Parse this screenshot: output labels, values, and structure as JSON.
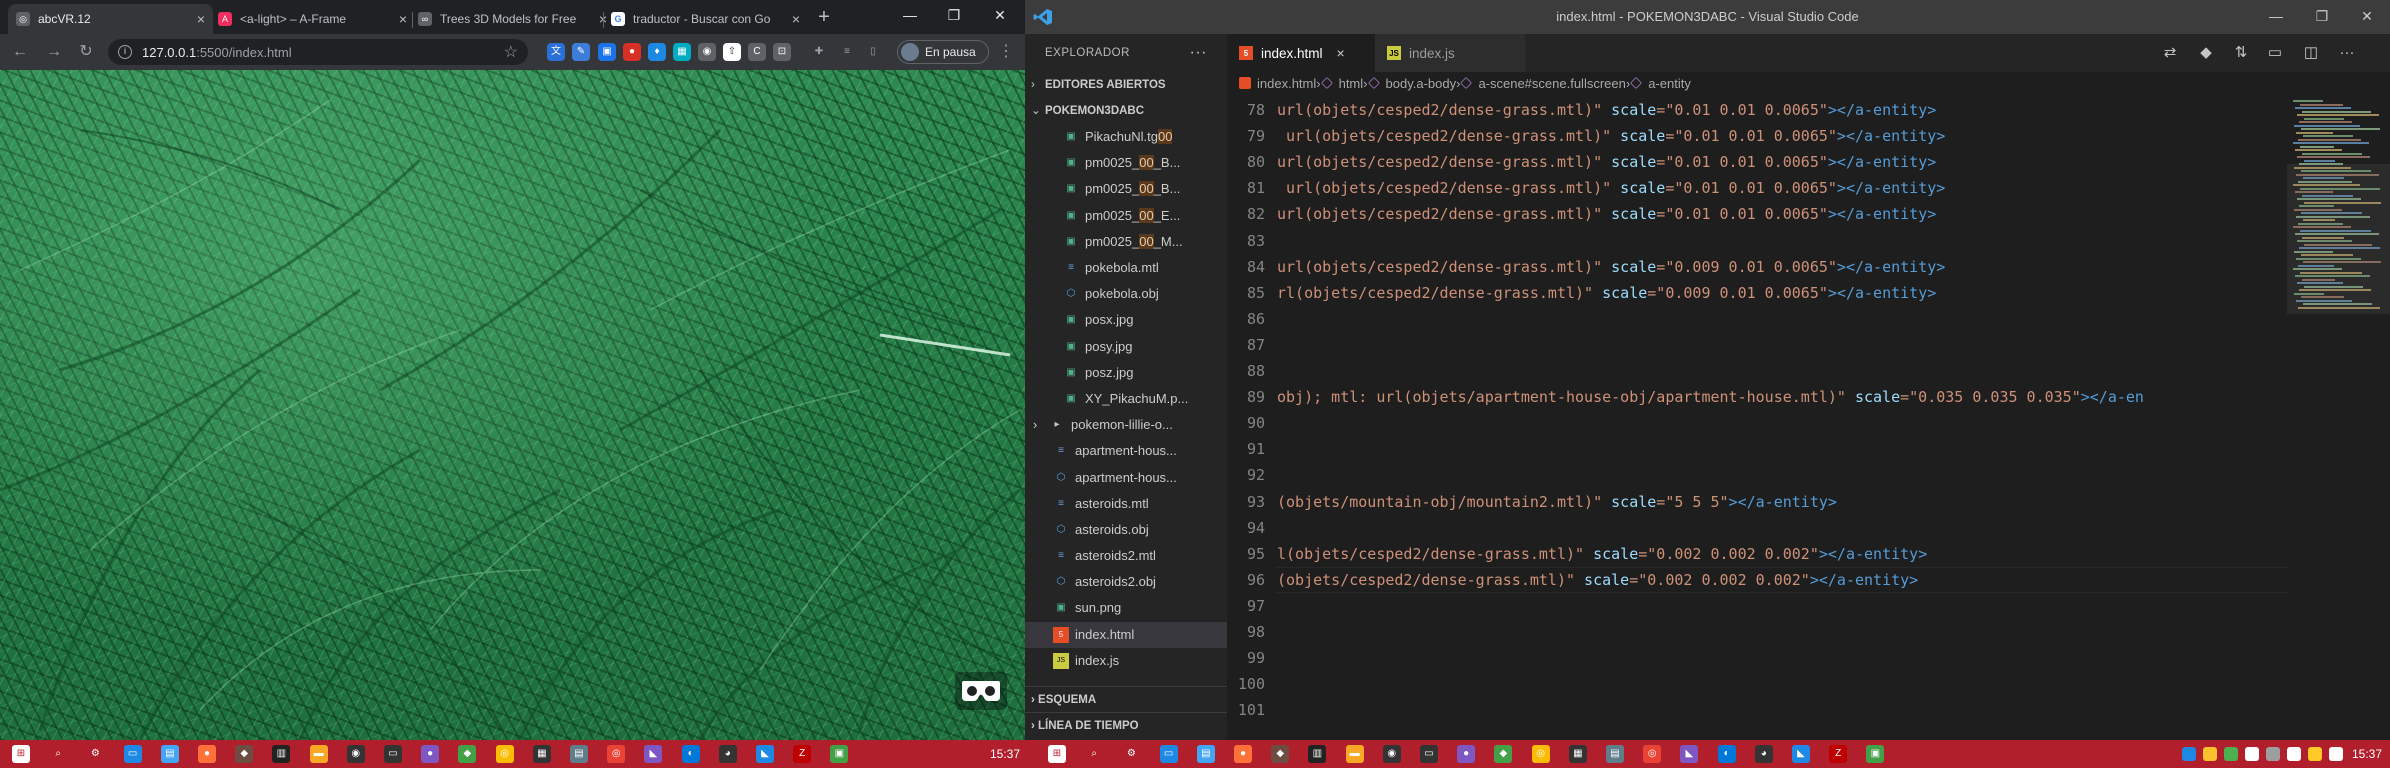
{
  "browser": {
    "tabs": [
      {
        "label": "abcVR.12",
        "icon": "globe-icon",
        "color": "#5f6368"
      },
      {
        "label": "<a-light> – A-Frame",
        "icon": "aframe-icon",
        "color": "#ef2d5e"
      },
      {
        "label": "Trees 3D Models for Free",
        "icon": "link-icon",
        "color": "#5f6368"
      },
      {
        "label": "traductor - Buscar con Go",
        "icon": "google-icon",
        "color": "#ffffff"
      }
    ],
    "close_glyph": "×",
    "new_tab_glyph": "+",
    "url_host": "127.0.0.1",
    "url_path": ":5500/index.html",
    "profile_label": "En pausa",
    "accent_color": "#2f8a52"
  },
  "vscode": {
    "window_title": "index.html - POKEMON3DABC - Visual Studio Code",
    "explorer_title": "EXPLORADOR",
    "open_editors": "EDITORES ABIERTOS",
    "project": "POKEMON3DABC",
    "files": [
      {
        "name": "PikachuNl.tg",
        "suffix": "00",
        "icon": "image-file-icon",
        "indent": 2
      },
      {
        "name": "pm0025_",
        "mid": "00",
        "suffix": "_B...",
        "icon": "image-file-icon",
        "indent": 2
      },
      {
        "name": "pm0025_",
        "mid": "00",
        "suffix": "_B...",
        "icon": "image-file-icon",
        "indent": 2
      },
      {
        "name": "pm0025_",
        "mid": "00",
        "suffix": "_E...",
        "icon": "image-file-icon",
        "indent": 2
      },
      {
        "name": "pm0025_",
        "mid": "00",
        "suffix": "_M...",
        "icon": "image-file-icon",
        "indent": 2
      },
      {
        "name": "pokebola.mtl",
        "icon": "text-file-icon",
        "indent": 2
      },
      {
        "name": "pokebola.obj",
        "icon": "cube-file-icon",
        "indent": 2
      },
      {
        "name": "posx.jpg",
        "icon": "image-file-icon",
        "indent": 2
      },
      {
        "name": "posy.jpg",
        "icon": "image-file-icon",
        "indent": 2
      },
      {
        "name": "posz.jpg",
        "icon": "image-file-icon",
        "indent": 2
      },
      {
        "name": "XY_PikachuM.p...",
        "icon": "image-file-icon",
        "indent": 2
      },
      {
        "name": "pokemon-lillie-o...",
        "icon": "folder-icon",
        "indent": 1,
        "folder": true
      },
      {
        "name": "apartment-hous...",
        "icon": "text-file-icon",
        "indent": 1
      },
      {
        "name": "apartment-hous...",
        "icon": "cube-file-icon",
        "indent": 1
      },
      {
        "name": "asteroids.mtl",
        "icon": "text-file-icon",
        "indent": 1
      },
      {
        "name": "asteroids.obj",
        "icon": "cube-file-icon",
        "indent": 1
      },
      {
        "name": "asteroids2.mtl",
        "icon": "text-file-icon",
        "indent": 1
      },
      {
        "name": "asteroids2.obj",
        "icon": "cube-file-icon",
        "indent": 1
      },
      {
        "name": "sun.png",
        "icon": "image-file-icon",
        "indent": 1
      },
      {
        "name": "index.html",
        "icon": "html-file-icon",
        "indent": 1,
        "selected": true
      },
      {
        "name": "index.js",
        "icon": "js-file-icon",
        "indent": 1
      }
    ],
    "outline": "ESQUEMA",
    "timeline": "LÍNEA DE TIEMPO",
    "editor_tabs": [
      {
        "label": "index.html",
        "icon": "html-file-icon",
        "active": true
      },
      {
        "label": "index.js",
        "icon": "js-file-icon",
        "active": false
      }
    ],
    "breadcrumb": [
      "index.html",
      "html",
      "body.a-body",
      "a-scene#scene.fullscreen",
      "a-entity"
    ],
    "code_lines": [
      {
        "n": "78",
        "pre": "url(objets/cesped2/dense-grass.mtl)\" ",
        "attr": "scale",
        "val": "=\"0.01 0.01 0.0065\"",
        "tail": "></a-entity>"
      },
      {
        "n": "79",
        "pre": " url(objets/cesped2/dense-grass.mtl)\" ",
        "attr": "scale",
        "val": "=\"0.01 0.01 0.0065\"",
        "tail": "></a-entity>"
      },
      {
        "n": "80",
        "pre": "url(objets/cesped2/dense-grass.mtl)\" ",
        "attr": "scale",
        "val": "=\"0.01 0.01 0.0065\"",
        "tail": "></a-entity>"
      },
      {
        "n": "81",
        "pre": " url(objets/cesped2/dense-grass.mtl)\" ",
        "attr": "scale",
        "val": "=\"0.01 0.01 0.0065\"",
        "tail": "></a-entity>"
      },
      {
        "n": "82",
        "pre": "url(objets/cesped2/dense-grass.mtl)\" ",
        "attr": "scale",
        "val": "=\"0.01 0.01 0.0065\"",
        "tail": "></a-entity>"
      },
      {
        "n": "83",
        "pre": "",
        "attr": "",
        "val": "",
        "tail": ""
      },
      {
        "n": "84",
        "pre": "url(objets/cesped2/dense-grass.mtl)\" ",
        "attr": "scale",
        "val": "=\"0.009 0.01 0.0065\"",
        "tail": "></a-entity>"
      },
      {
        "n": "85",
        "pre": "rl(objets/cesped2/dense-grass.mtl)\" ",
        "attr": "scale",
        "val": "=\"0.009 0.01 0.0065\"",
        "tail": "></a-entity>"
      },
      {
        "n": "86",
        "pre": "",
        "attr": "",
        "val": "",
        "tail": ""
      },
      {
        "n": "87",
        "pre": "",
        "attr": "",
        "val": "",
        "tail": ""
      },
      {
        "n": "88",
        "pre": "",
        "attr": "",
        "val": "",
        "tail": ""
      },
      {
        "n": "89",
        "pre": "obj); mtl: url(objets/apartment-house-obj/apartment-house.mtl)\" ",
        "attr": "scale",
        "val": "=\"0.035 0.035 0.035\"",
        "tail": "></a-en"
      },
      {
        "n": "90",
        "pre": "",
        "attr": "",
        "val": "",
        "tail": ""
      },
      {
        "n": "91",
        "pre": "",
        "attr": "",
        "val": "",
        "tail": ""
      },
      {
        "n": "92",
        "pre": "",
        "attr": "",
        "val": "",
        "tail": ""
      },
      {
        "n": "93",
        "pre": "(objets/mountain-obj/mountain2.mtl)\" ",
        "attr": "scale",
        "val": "=\"5 5 5\"",
        "tail": "></a-entity>"
      },
      {
        "n": "94",
        "pre": "",
        "attr": "",
        "val": "",
        "tail": ""
      },
      {
        "n": "95",
        "pre": "l(objets/cesped2/dense-grass.mtl)\" ",
        "attr": "scale",
        "val": "=\"0.002 0.002 0.002\"",
        "tail": "></a-entity>"
      },
      {
        "n": "96",
        "pre": "(objets/cesped2/dense-grass.mtl)\" ",
        "attr": "scale",
        "val": "=\"0.002 0.002 0.002\"",
        "tail": "></a-entity>"
      },
      {
        "n": "97",
        "pre": "",
        "attr": "",
        "val": "",
        "tail": ""
      },
      {
        "n": "98",
        "pre": "",
        "attr": "",
        "val": "",
        "tail": ""
      },
      {
        "n": "99",
        "pre": "",
        "attr": "",
        "val": "",
        "tail": ""
      },
      {
        "n": "100",
        "pre": "",
        "attr": "",
        "val": "",
        "tail": ""
      },
      {
        "n": "101",
        "pre": "",
        "attr": "",
        "val": "",
        "tail": ""
      }
    ],
    "cursor_line": "96"
  },
  "taskbar": {
    "color": "#b21f2c",
    "clock_left": "15:37",
    "clock_right": "15:37"
  }
}
